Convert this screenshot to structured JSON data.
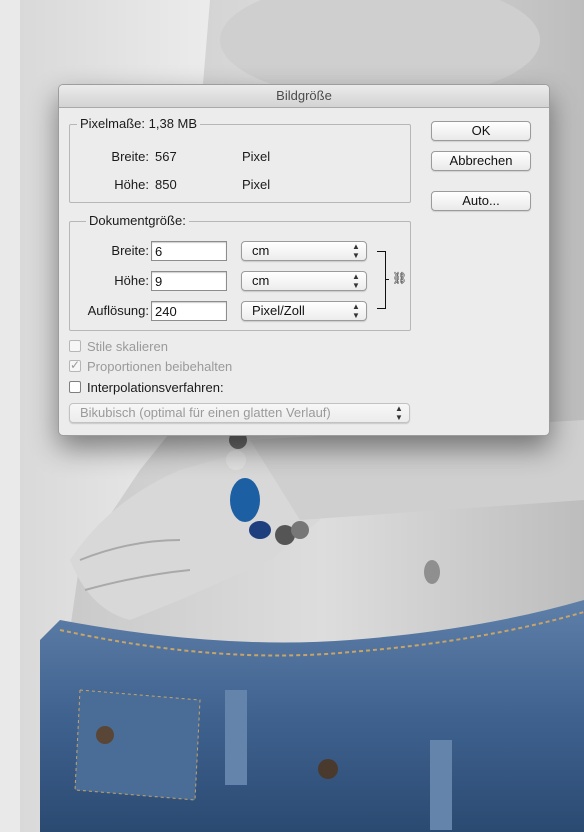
{
  "dialog": {
    "title": "Bildgröße",
    "pixel_dimensions": {
      "legend": "Pixelmaße: 1,38 MB",
      "width_label": "Breite:",
      "width_value": "567",
      "width_unit": "Pixel",
      "height_label": "Höhe:",
      "height_value": "850",
      "height_unit": "Pixel"
    },
    "document_size": {
      "legend": "Dokumentgröße:",
      "width_label": "Breite:",
      "width_value": "6",
      "width_unit": "cm",
      "height_label": "Höhe:",
      "height_value": "9",
      "height_unit": "cm",
      "resolution_label": "Auflösung:",
      "resolution_value": "240",
      "resolution_unit": "Pixel/Zoll"
    },
    "buttons": {
      "ok": "OK",
      "cancel": "Abbrechen",
      "auto": "Auto..."
    },
    "options": {
      "scale_styles": "Stile skalieren",
      "constrain_proportions": "Proportionen beibehalten",
      "resample": "Interpolationsverfahren:",
      "resample_method": "Bikubisch (optimal für einen glatten Verlauf)"
    }
  }
}
